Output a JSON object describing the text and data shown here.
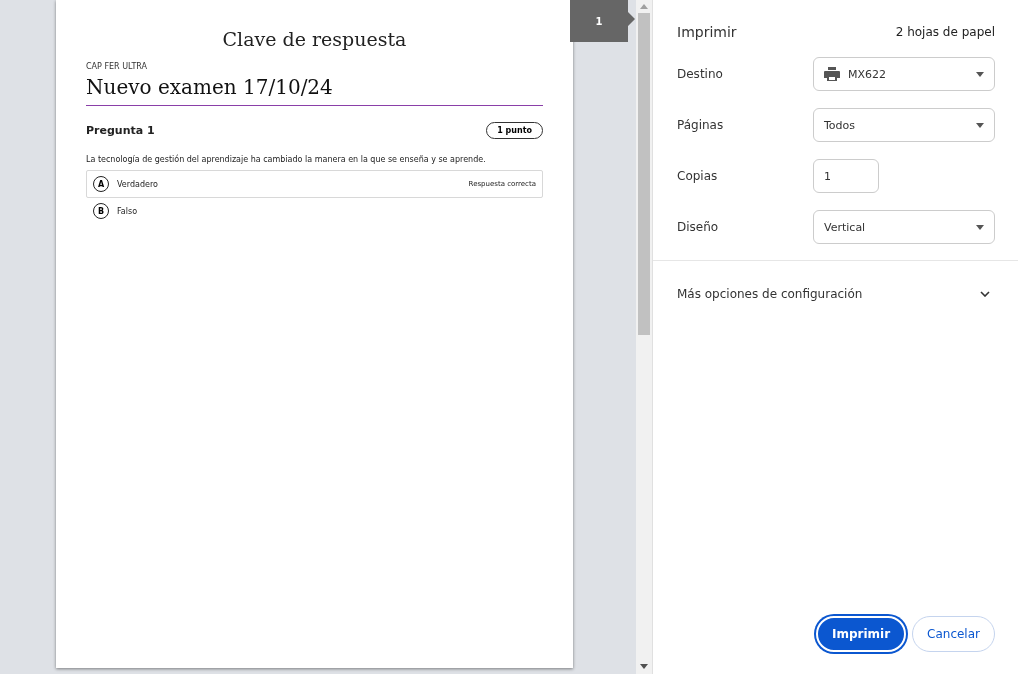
{
  "preview": {
    "page_number": "1",
    "document": {
      "title": "Clave de respuesta",
      "course": "CAP FER ULTRA",
      "exam": "Nuevo examen 17/10/24",
      "questions": [
        {
          "heading": "Pregunta 1",
          "points": "1 punto",
          "text": "La tecnología de gestión del aprendizaje ha cambiado la manera en la que se enseña y se aprende.",
          "answers": [
            {
              "letter": "A",
              "text": "Verdadero",
              "correct": true,
              "note": "Respuesta correcta"
            },
            {
              "letter": "B",
              "text": "Falso",
              "correct": false
            }
          ]
        }
      ]
    }
  },
  "panel": {
    "title": "Imprimir",
    "sheets": "2 hojas de papel",
    "options": [
      {
        "label": "Destino",
        "kind": "printer",
        "value": "MX622"
      },
      {
        "label": "Páginas",
        "kind": "select",
        "value": "Todos"
      },
      {
        "label": "Copias",
        "kind": "number",
        "value": "1"
      },
      {
        "label": "Diseño",
        "kind": "select",
        "value": "Vertical"
      }
    ],
    "more": {
      "label": "Más opciones de configuración",
      "expanded": false
    },
    "buttons": [
      {
        "label": "Imprimir",
        "kind": "primary"
      },
      {
        "label": "Cancelar",
        "kind": "secondary"
      }
    ]
  }
}
